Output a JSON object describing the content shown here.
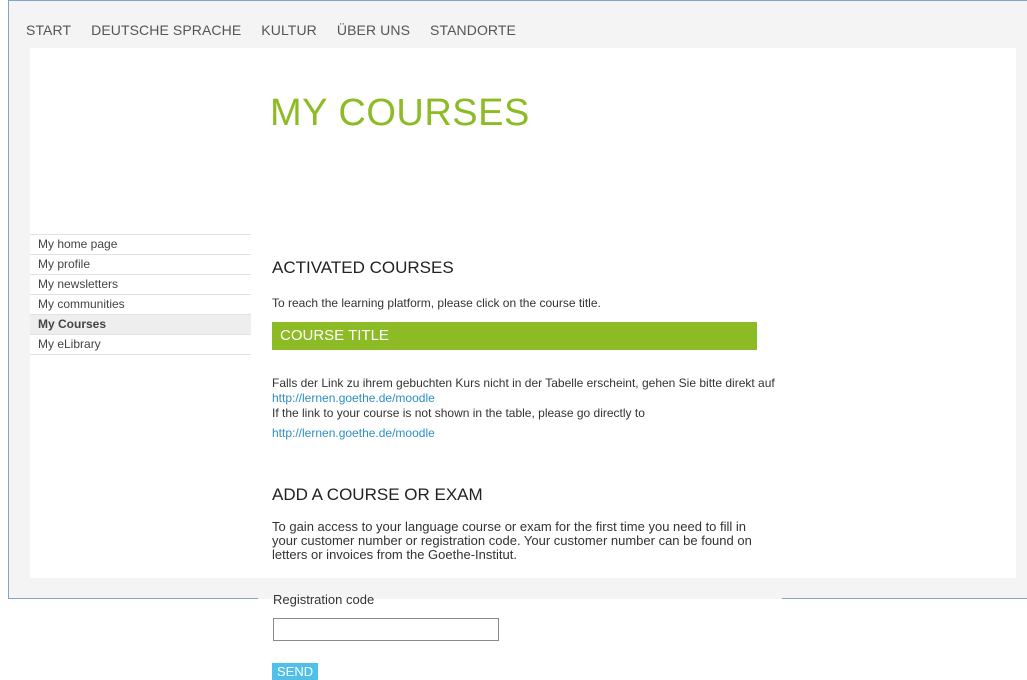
{
  "topnav": {
    "items": [
      "START",
      "DEUTSCHE SPRACHE",
      "KULTUR",
      "ÜBER UNS",
      "STANDORTE"
    ]
  },
  "page": {
    "title": "MY COURSES"
  },
  "sidebar": {
    "items": [
      {
        "label": "My home page",
        "active": false
      },
      {
        "label": "My profile",
        "active": false
      },
      {
        "label": "My newsletters",
        "active": false
      },
      {
        "label": "My communities",
        "active": false
      },
      {
        "label": "My Courses",
        "active": true
      },
      {
        "label": "My eLibrary",
        "active": false
      }
    ]
  },
  "activated": {
    "heading": "ACTIVATED COURSES",
    "instruction": "To reach the learning platform, please click on the course title.",
    "table_header": "COURSE TITLE",
    "note_de": "Falls der Link zu ihrem gebuchten Kurs nicht in der Tabelle erscheint, gehen Sie bitte direkt auf",
    "link_1": "http://lernen.goethe.de/moodle",
    "note_en": "If the link to your course is not shown in the table, please go directly to",
    "link_2": "http://lernen.goethe.de/moodle"
  },
  "add": {
    "heading": "ADD A COURSE OR EXAM",
    "paragraph": "To gain access to your language course or exam for the first time you need to fill in your customer number or registration code. Your customer number can be found on letters or invoices from the Goethe-Institut.",
    "reg_label": "Registration code",
    "reg_value": "",
    "send_label": "SEND"
  },
  "colors": {
    "accent_green": "#8dbb25",
    "link_blue": "#2b8fc7",
    "button_blue": "#4fc0e8",
    "frame_blue": "#7fa5c9"
  }
}
